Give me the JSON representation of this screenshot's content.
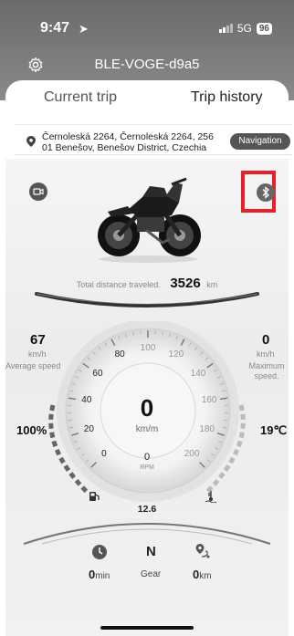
{
  "status_bar": {
    "time": "9:47",
    "network": "5G",
    "battery": "96"
  },
  "header": {
    "title": "BLE-VOGE-d9a5",
    "settings_icon": "gear-icon"
  },
  "tabs": [
    {
      "label": "Current trip",
      "selected": true
    },
    {
      "label": "Trip history",
      "selected": false
    }
  ],
  "location": {
    "address": "Černoleská 2264, Černoleská 2264, 256 01 Benešov, Benešov District, Czechia",
    "navigation_label": "Navigation"
  },
  "vehicle": {
    "camera_icon": "camera-icon",
    "bluetooth_icon": "bluetooth-icon",
    "total_distance_label": "Total distance traveled.",
    "total_distance_value": "3526",
    "total_distance_unit": "km"
  },
  "speedometer": {
    "speed": "0",
    "speed_unit": "km/m",
    "rpm": "0",
    "rpm_label": "RPM",
    "ticks": [
      "0",
      "20",
      "40",
      "60",
      "80",
      "100",
      "120",
      "140",
      "160",
      "180",
      "200"
    ]
  },
  "stats": {
    "average_speed_value": "67",
    "average_speed_unit": "km/h",
    "average_speed_label": "Average speed",
    "maximum_speed_value": "0",
    "maximum_speed_unit": "km/h",
    "maximum_speed_label": "Maximum speed.",
    "battery_percent": "100%",
    "temperature": "19℃",
    "voltage": "12.6"
  },
  "bottom": {
    "time_value": "0",
    "time_unit": "min",
    "gear_value": "N",
    "gear_label": "Gear",
    "trip_value": "0",
    "trip_unit": "km"
  },
  "colors": {
    "header_bg": "#777777",
    "highlight": "#e8202a",
    "gauge_dark": "#444444"
  }
}
